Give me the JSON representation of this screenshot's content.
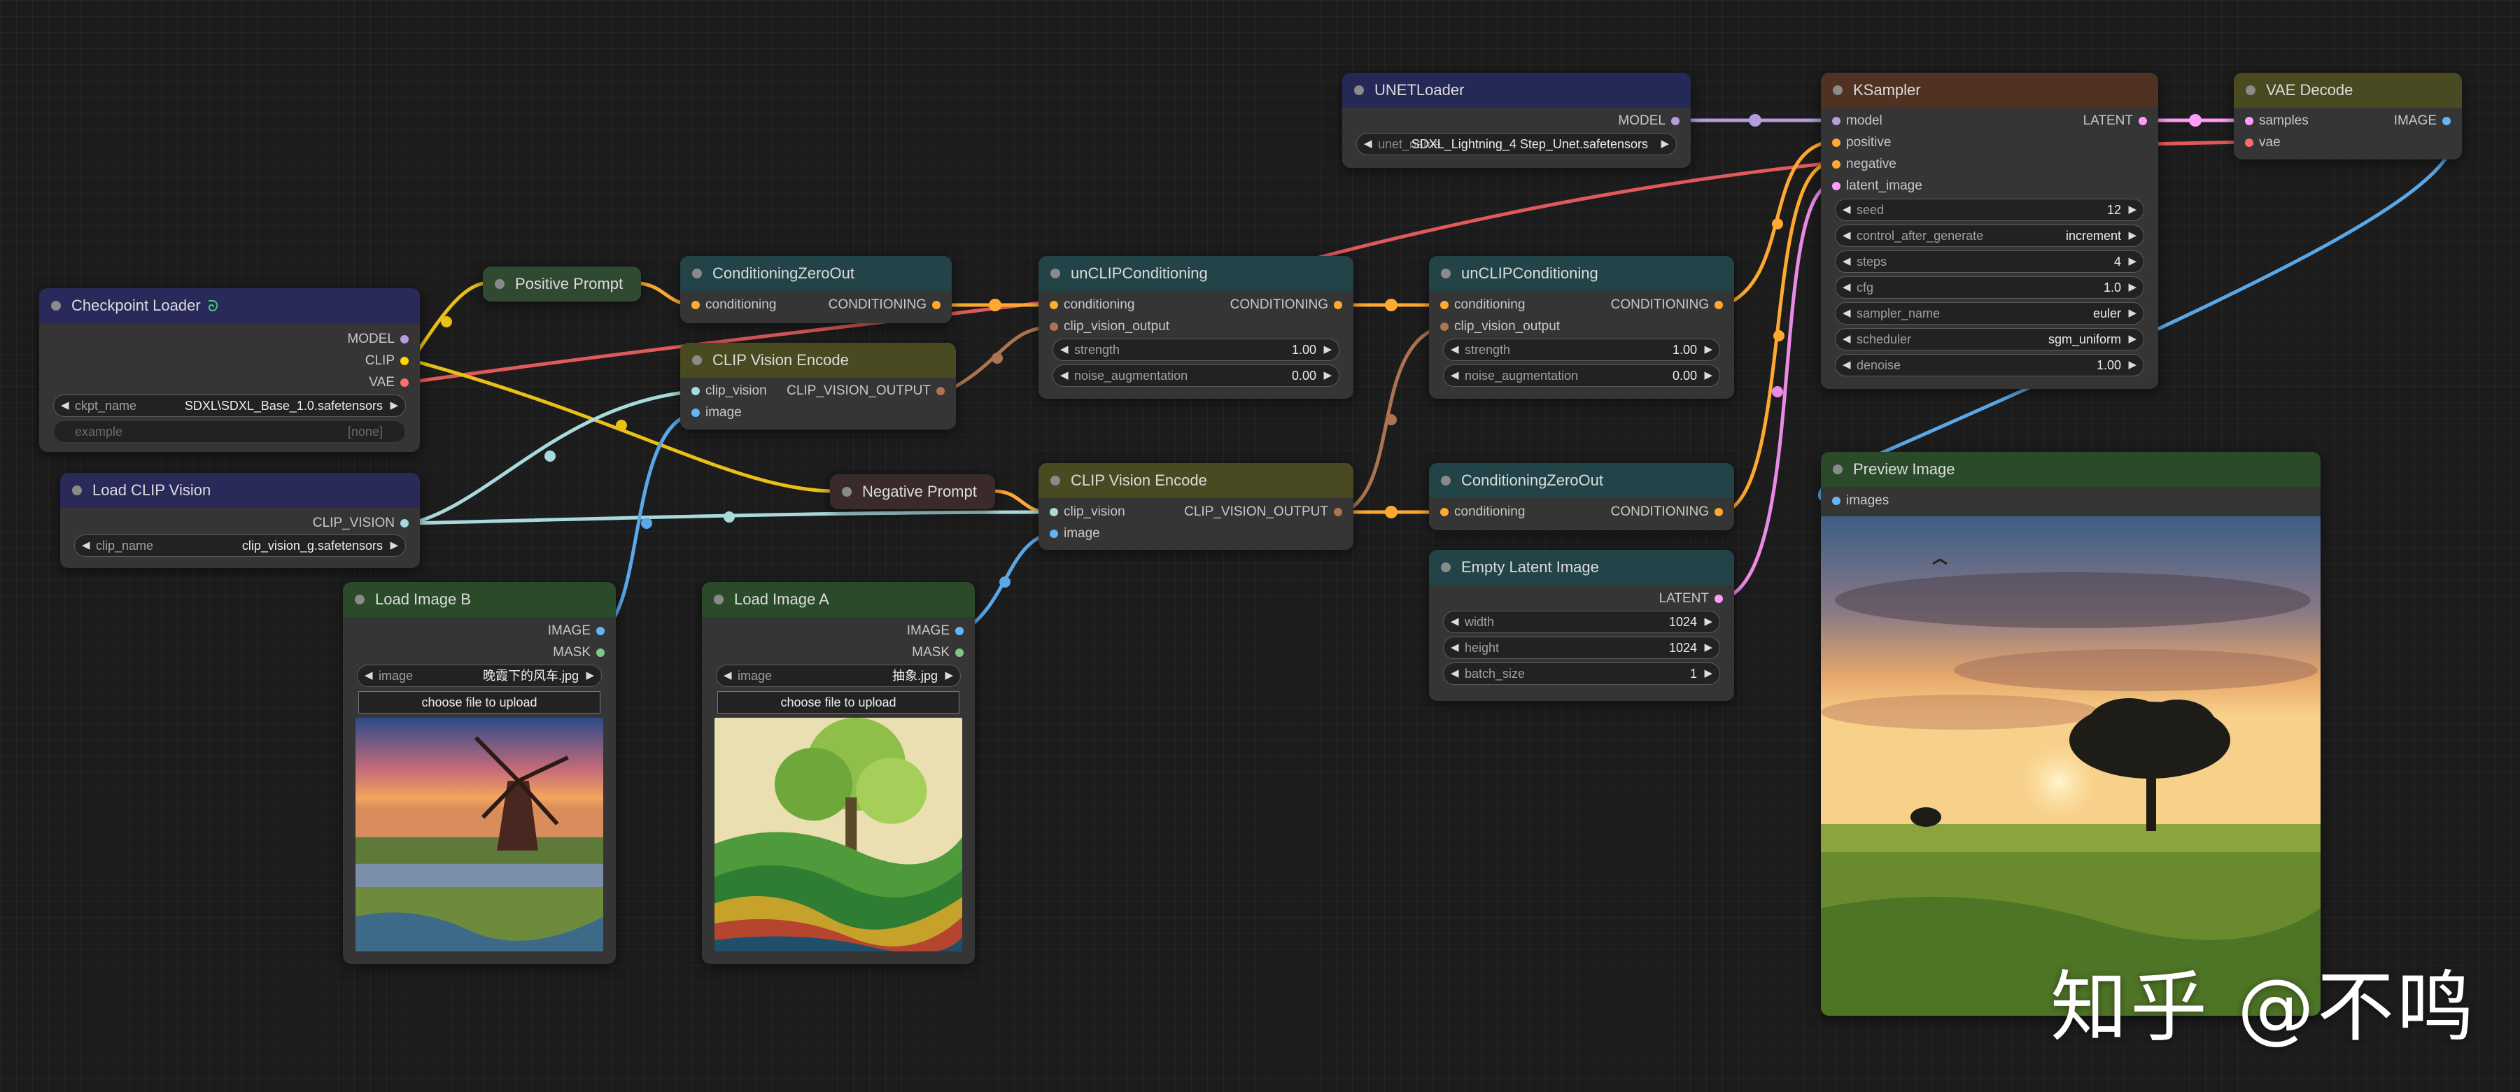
{
  "nodes": {
    "unet_loader": {
      "title": "UNETLoader",
      "out_model": "MODEL",
      "unet_label": "unet_name",
      "unet_value": "SDXL_Lightning_4 Step_Unet.safetensors"
    },
    "ksampler": {
      "title": "KSampler",
      "inputs": [
        "model",
        "positive",
        "negative",
        "latent_image"
      ],
      "out_latent": "LATENT",
      "widgets": [
        {
          "label": "seed",
          "value": "12"
        },
        {
          "label": "control_after_generate",
          "value": "increment"
        },
        {
          "label": "steps",
          "value": "4"
        },
        {
          "label": "cfg",
          "value": "1.0"
        },
        {
          "label": "sampler_name",
          "value": "euler"
        },
        {
          "label": "scheduler",
          "value": "sgm_uniform"
        },
        {
          "label": "denoise",
          "value": "1.00"
        }
      ]
    },
    "vae_decode": {
      "title": "VAE Decode",
      "in_samples": "samples",
      "in_vae": "vae",
      "out_image": "IMAGE"
    },
    "checkpoint_loader": {
      "title": "Checkpoint Loader",
      "outputs": [
        "MODEL",
        "CLIP",
        "VAE"
      ],
      "ckpt_label": "ckpt_name",
      "ckpt_value": "SDXL\\SDXL_Base_1.0.safetensors",
      "example_label": "example",
      "example_value": "[none]"
    },
    "positive_prompt": {
      "title": "Positive Prompt"
    },
    "negative_prompt": {
      "title": "Negative Prompt"
    },
    "cond_zero_out_1": {
      "title": "ConditioningZeroOut",
      "in": "conditioning",
      "out": "CONDITIONING"
    },
    "cond_zero_out_2": {
      "title": "ConditioningZeroOut",
      "in": "conditioning",
      "out": "CONDITIONING"
    },
    "clip_vision_encode_1": {
      "title": "CLIP Vision Encode",
      "in_clip": "clip_vision",
      "in_image": "image",
      "out": "CLIP_VISION_OUTPUT"
    },
    "clip_vision_encode_2": {
      "title": "CLIP Vision Encode",
      "in_clip": "clip_vision",
      "in_image": "image",
      "out": "CLIP_VISION_OUTPUT"
    },
    "unclip_1": {
      "title": "unCLIPConditioning",
      "in_cond": "conditioning",
      "in_cvo": "clip_vision_output",
      "out": "CONDITIONING",
      "strength_label": "strength",
      "strength_value": "1.00",
      "noise_label": "noise_augmentation",
      "noise_value": "0.00"
    },
    "unclip_2": {
      "title": "unCLIPConditioning",
      "in_cond": "conditioning",
      "in_cvo": "clip_vision_output",
      "out": "CONDITIONING",
      "strength_label": "strength",
      "strength_value": "1.00",
      "noise_label": "noise_augmentation",
      "noise_value": "0.00"
    },
    "load_clip_vision": {
      "title": "Load CLIP Vision",
      "out": "CLIP_VISION",
      "clip_label": "clip_name",
      "clip_value": "clip_vision_g.safetensors"
    },
    "load_image_b": {
      "title": "Load Image B",
      "out_image": "IMAGE",
      "out_mask": "MASK",
      "image_label": "image",
      "image_value": "晚霞下的风车.jpg",
      "upload": "choose file to upload"
    },
    "load_image_a": {
      "title": "Load Image A",
      "out_image": "IMAGE",
      "out_mask": "MASK",
      "image_label": "image",
      "image_value": "抽象.jpg",
      "upload": "choose file to upload"
    },
    "empty_latent": {
      "title": "Empty Latent Image",
      "out": "LATENT",
      "widgets": [
        {
          "label": "width",
          "value": "1024"
        },
        {
          "label": "height",
          "value": "1024"
        },
        {
          "label": "batch_size",
          "value": "1"
        }
      ]
    },
    "preview_image": {
      "title": "Preview Image",
      "in": "images"
    }
  },
  "watermark": "知乎 @不鸣",
  "colors": {
    "model": "#b39ddb",
    "clip": "#ffd500",
    "vae": "#ff6e6e",
    "conditioning": "#ffa931",
    "clip_vision": "#a8dadc",
    "image": "#64b5f6",
    "latent": "#ff9cf9",
    "clip_vision_output": "#ad7452",
    "mask": "#81c784"
  }
}
